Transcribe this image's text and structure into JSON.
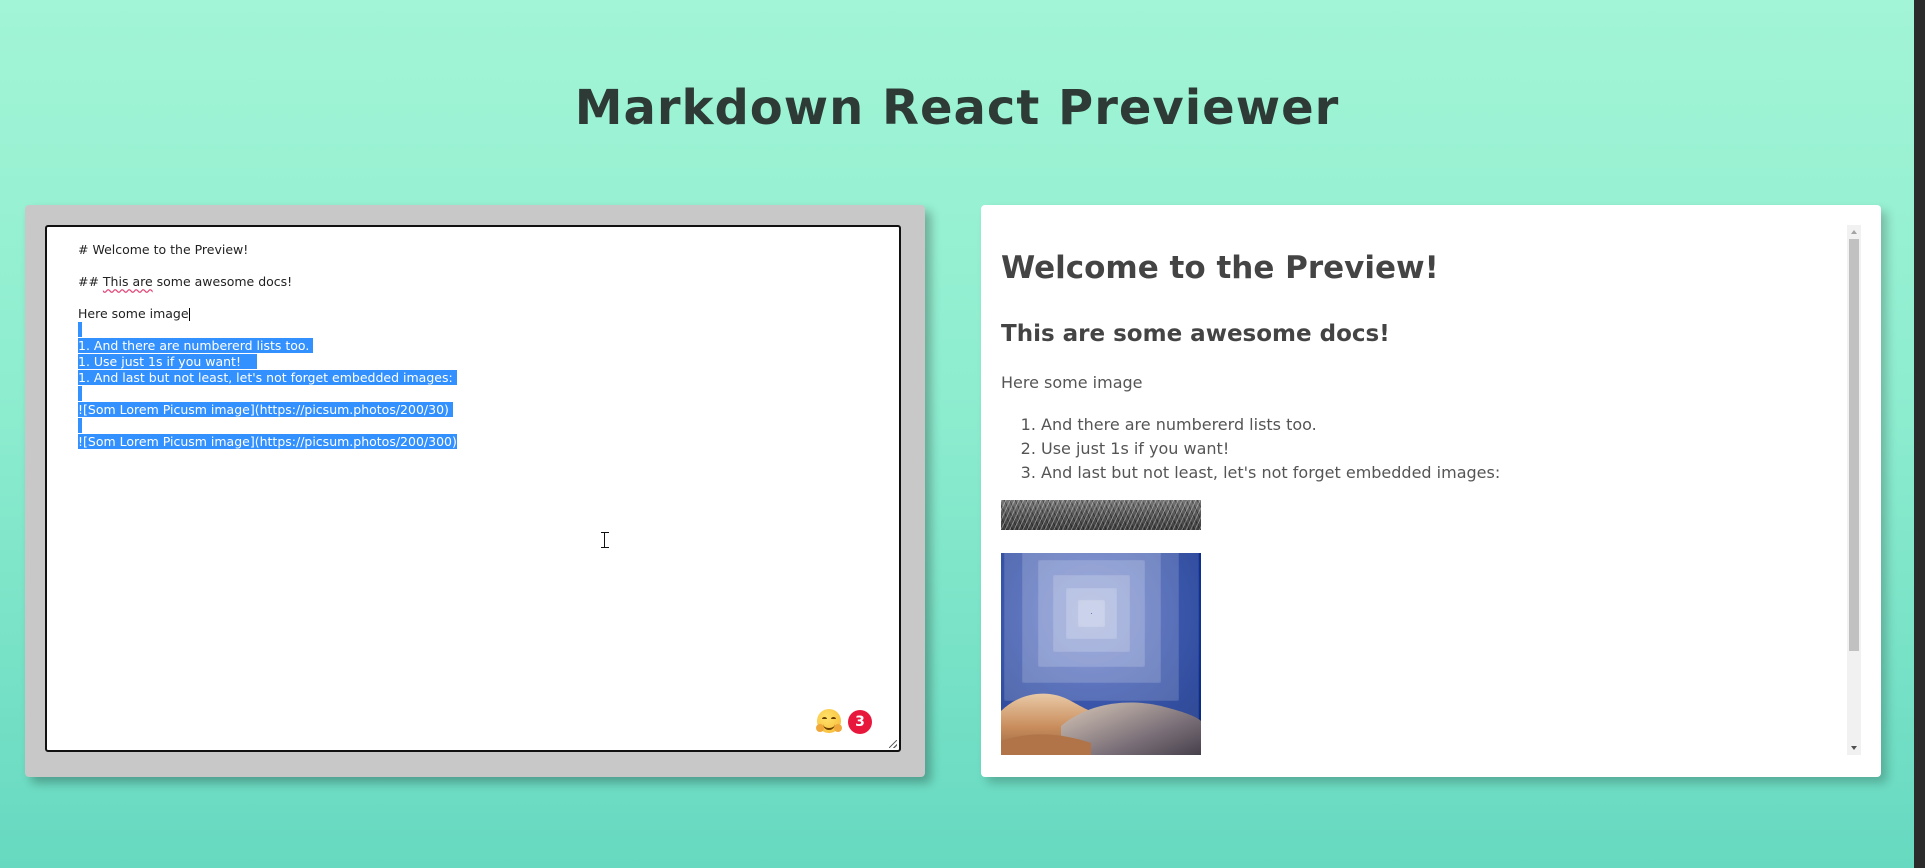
{
  "title": "Markdown React Previewer",
  "editor": {
    "lines": {
      "l1": "# Welcome to the Preview!",
      "l2_prefix": "## ",
      "l2_misspelled": "This are",
      "l2_suffix": " some awesome docs!",
      "l3": "Here some image",
      "l5": "1. And there are numbererd lists too.",
      "l6": "1. Use just 1s if you want!",
      "l7": "1. And last but not least, let's not forget embedded images:",
      "l9": "![Som Lorem Picusm image](https://picsum.photos/200/30)",
      "l11": "![Som Lorem Picusm image](https://picsum.photos/200/300)"
    },
    "extension_badge_count": "3"
  },
  "preview": {
    "h1": "Welcome to the Preview!",
    "h2": "This are some awesome docs!",
    "paragraph": "Here some image",
    "list": [
      "And there are numbererd lists too.",
      "Use just 1s if you want!",
      "And last but not least, let's not forget embedded images:"
    ],
    "images": {
      "first_alt": "Som Lorem Picusm image",
      "second_alt": "Som Lorem Picusm image"
    }
  },
  "colors": {
    "background_top": "#a2f5d6",
    "background_bottom": "#66d9c0",
    "selection": "#3390ff",
    "badge": "#e8183d",
    "editor_frame": "#c8c8c8"
  },
  "icons": {
    "extension": "hugging-face-emoji-icon",
    "cursor": "text-ibeam-cursor-icon"
  }
}
